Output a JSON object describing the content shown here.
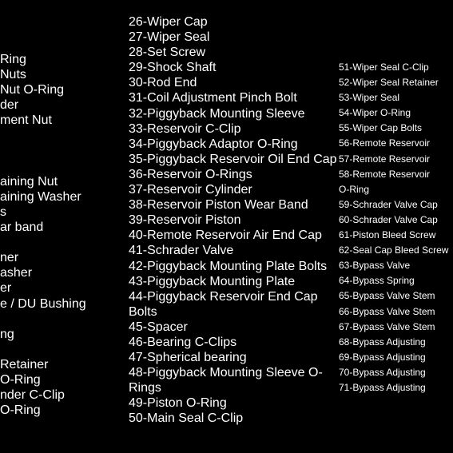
{
  "columns": [
    {
      "items": [
        "Ring",
        "Nuts",
        "Nut O-Ring",
        "der",
        "ment Nut",
        "",
        "",
        "",
        "aining Nut",
        "aining Washer",
        "s",
        "ar band",
        "",
        "ner",
        "asher",
        "er",
        "e / DU Bushing",
        "",
        "ng",
        "",
        "Retainer",
        "O-Ring",
        "nder C-Clip",
        "O-Ring"
      ]
    },
    {
      "items": [
        "26-Wiper Cap",
        "27-Wiper Seal",
        "28-Set Screw",
        "29-Shock Shaft",
        "30-Rod End",
        "31-Coil Adjustment Pinch Bolt",
        "32-Piggyback Mounting Sleeve",
        "33-Reservoir C-Clip",
        "34-Piggyback Adaptor O-Ring",
        "35-Piggyback Reservoir Oil End Cap",
        "36-Reservoir O-Rings",
        "37-Reservoir Cylinder",
        "38-Reservoir Piston Wear Band",
        "39-Reservoir Piston",
        "40-Remote Reservoir Air End Cap",
        "41-Schrader Valve",
        "42-Piggyback Mounting Plate Bolts",
        "43-Piggyback Mounting Plate",
        "44-Piggyback Reservoir End Cap Bolts",
        "45-Spacer",
        "46-Bearing C-Clips",
        "47-Spherical bearing",
        "48-Piggyback Mounting Sleeve O-Rings",
        "49-Piston O-Ring",
        "50-Main Seal C-Clip"
      ]
    },
    {
      "items": [
        "51-Wiper Seal C-Clip",
        "52-Wiper Seal Retainer",
        "53-Wiper Seal",
        "54-Wiper O-Ring",
        "55-Wiper Cap Bolts",
        "56-Remote Reservoir",
        "57-Remote Reservoir",
        "58-Remote Reservoir O-Ring",
        "59-Schrader Valve Cap",
        "60-Schrader Valve Cap",
        "61-Piston Bleed Screw",
        "62-Seal Cap Bleed Screw",
        "63-Bypass Valve",
        "64-Bypass Spring",
        "65-Bypass Valve Stem",
        "66-Bypass Valve Stem",
        "67-Bypass Valve Stem",
        "68-Bypass Adjusting",
        "69-Bypass Adjusting",
        "70-Bypass Adjusting",
        "71-Bypass Adjusting"
      ]
    }
  ]
}
